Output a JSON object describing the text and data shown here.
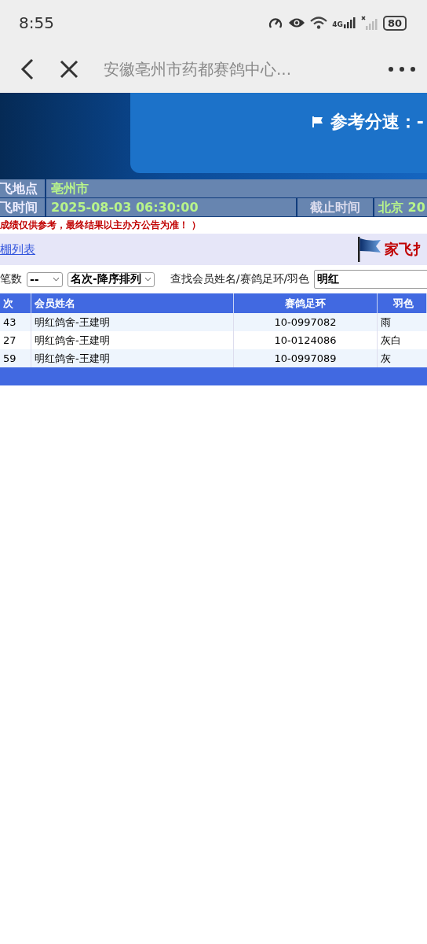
{
  "status_bar": {
    "time": "8:55",
    "network": "4G",
    "battery": "80"
  },
  "nav": {
    "title": "安徽亳州市药都赛鸽中心..."
  },
  "banner": {
    "speed_label": "参考分速：-"
  },
  "info": [
    {
      "label": "飞地点",
      "value": "亳州市"
    },
    {
      "label": "飞时间",
      "value": "2025-08-03 06:30:00",
      "extra_label": "截止时间",
      "extra_value": "北京  20"
    }
  ],
  "notice": "成绩仅供参考，最终结果以主办方公告为准！ ）",
  "subbar": {
    "link": "棚列表",
    "title": "家飞扌"
  },
  "filters": {
    "count_label": "笔数",
    "count_value": "--",
    "sort_value": "名次-降序排列",
    "search_label": "查找会员姓名/赛鸽足环/羽色",
    "search_value": "明红"
  },
  "table": {
    "columns": [
      "次",
      "会员姓名",
      "赛鸽足环",
      "羽色"
    ],
    "rows": [
      [
        "43",
        "明红鸽舍-王建明",
        "10-0997082",
        "雨"
      ],
      [
        "27",
        "明红鸽舍-王建明",
        "10-0124086",
        "灰白"
      ],
      [
        "59",
        "明红鸽舍-王建明",
        "10-0997089",
        "灰"
      ]
    ]
  }
}
